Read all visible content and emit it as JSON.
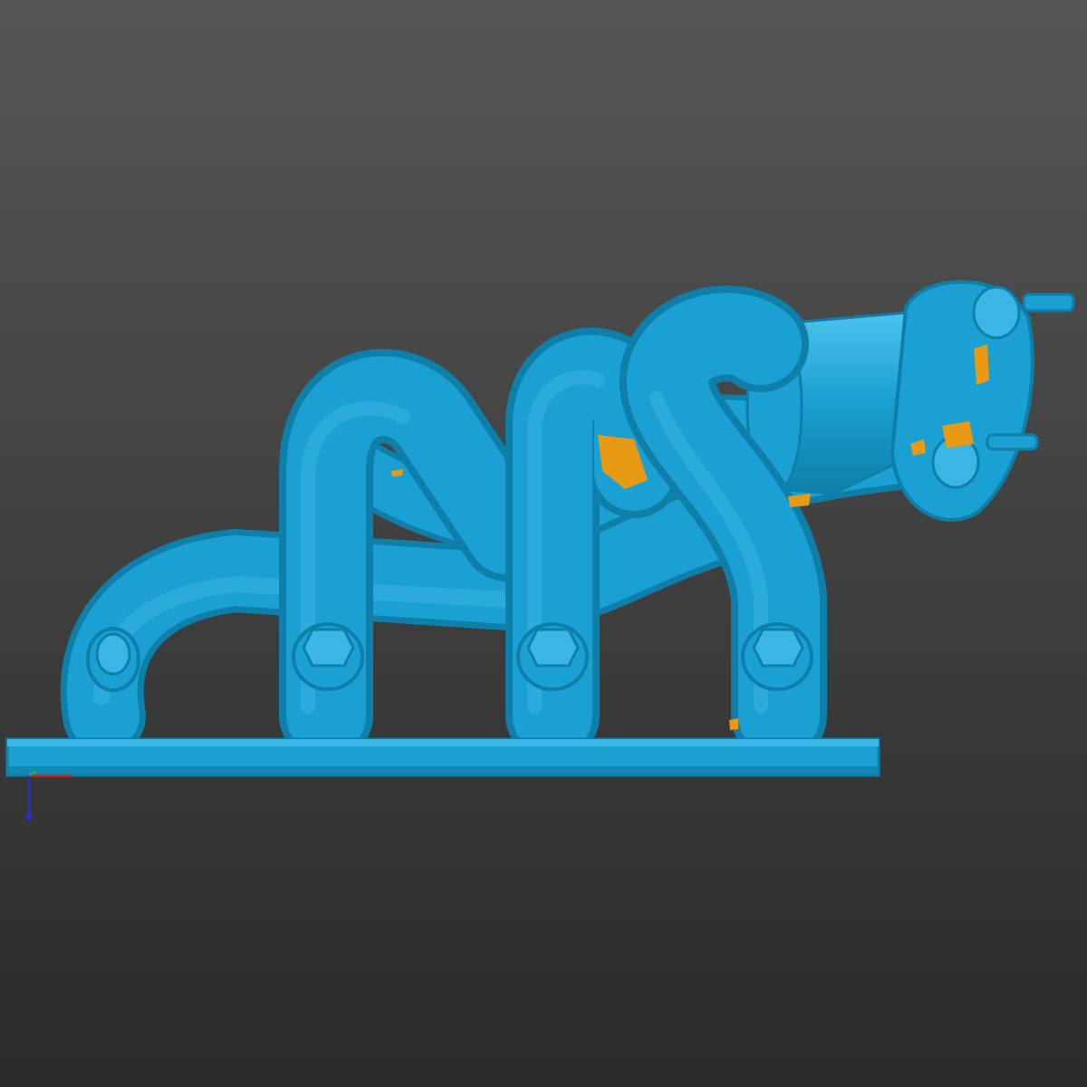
{
  "viewport": {
    "background_top": "#565656",
    "background_bottom": "#2a2a2a"
  },
  "model": {
    "name": "exhaust-manifold-scan",
    "mesh_color": "#1aa0d2",
    "mesh_shadow_color": "#0e7fa8",
    "mesh_highlight_color": "#4fc4ee",
    "deviation_color": "#e89a14"
  },
  "axis_triad": {
    "x_color": "#e02020",
    "y_color": "#20c020",
    "z_color": "#2030e0"
  }
}
